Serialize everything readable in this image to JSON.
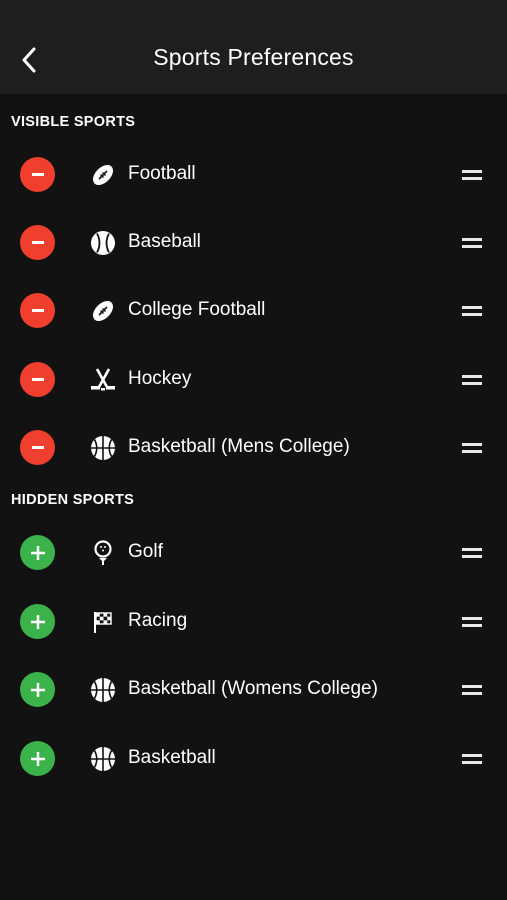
{
  "header": {
    "title": "Sports Preferences",
    "back_icon": "chevron-left-icon"
  },
  "visible_section": {
    "label": "VISIBLE SPORTS",
    "items": [
      {
        "label": "Football",
        "icon": "football-icon"
      },
      {
        "label": "Baseball",
        "icon": "baseball-icon"
      },
      {
        "label": "College Football",
        "icon": "football-icon"
      },
      {
        "label": "Hockey",
        "icon": "hockey-icon"
      },
      {
        "label": "Basketball (Mens College)",
        "icon": "basketball-icon"
      }
    ]
  },
  "hidden_section": {
    "label": "HIDDEN SPORTS",
    "items": [
      {
        "label": "Golf",
        "icon": "golf-icon"
      },
      {
        "label": "Racing",
        "icon": "racing-flag-icon"
      },
      {
        "label": "Basketball (Womens College)",
        "icon": "basketball-icon"
      },
      {
        "label": "Basketball",
        "icon": "basketball-icon"
      }
    ]
  },
  "colors": {
    "background": "#121212",
    "header": "#1e1e1e",
    "remove": "#f03f2e",
    "add": "#3cb34a",
    "text": "#ffffff"
  }
}
